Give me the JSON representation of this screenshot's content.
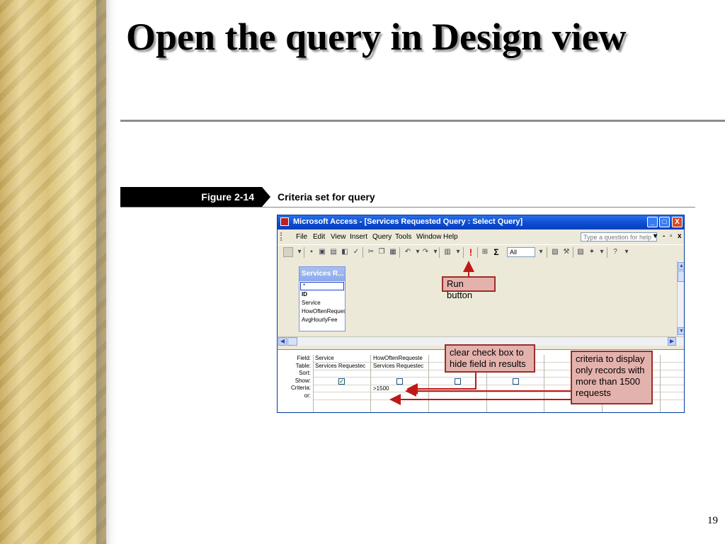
{
  "slide": {
    "title": "Open the query in Design view",
    "page_number": "19"
  },
  "figure": {
    "number": "Figure 2-14",
    "caption": "Criteria set for query"
  },
  "window": {
    "title": "Microsoft Access - [Services Requested Query : Select Query]",
    "controls": {
      "minimize": "_",
      "maximize": "□",
      "close": "X"
    }
  },
  "menubar": {
    "items": [
      "File",
      "Edit",
      "View",
      "Insert",
      "Query",
      "Tools",
      "Window",
      "Help"
    ],
    "help_placeholder": "Type a question for help",
    "doc_controls": [
      "-",
      "▫",
      "x"
    ]
  },
  "toolbar": {
    "top_values": "All",
    "sigma": "Σ"
  },
  "field_list": {
    "title": "Services R...",
    "fields": [
      "*",
      "ID",
      "Service",
      "HowOftenRequested",
      "AvgHourlyFee"
    ]
  },
  "design_grid": {
    "row_labels": [
      "Field:",
      "Table:",
      "Sort:",
      "Show:",
      "Criteria:",
      "or:"
    ],
    "columns": [
      {
        "field": "Service",
        "table": "Services Requestec",
        "show": true,
        "criteria": ""
      },
      {
        "field": "HowOftenRequeste",
        "table": "Services Requestec",
        "show": false,
        "criteria": ">1500"
      },
      {
        "field": "",
        "table": "",
        "show": false,
        "criteria": ""
      },
      {
        "field": "",
        "table": "",
        "show": false,
        "criteria": ""
      }
    ]
  },
  "callouts": {
    "run_button": "Run button",
    "clear_checkbox": "clear check box to hide field in results",
    "criteria_display": "criteria to display only records with more than 1500 requests"
  },
  "colors": {
    "callout_fill": "#e4b2ad",
    "callout_border": "#9a2e2a",
    "titlebar_blue": "#0a4bd0",
    "band_gold": "#d7bd72"
  }
}
